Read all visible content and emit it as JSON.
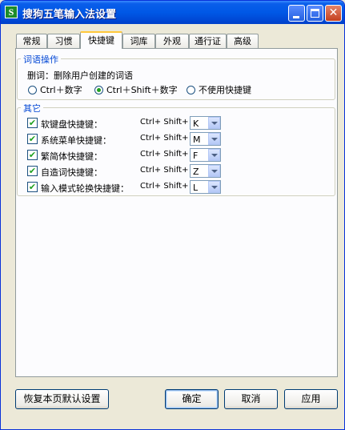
{
  "window": {
    "title": "搜狗五笔输入法设置"
  },
  "tabs": [
    "常规",
    "习惯",
    "快捷键",
    "词库",
    "外观",
    "通行证",
    "高级"
  ],
  "active_tab": "快捷键",
  "word_ops": {
    "group_label": "词语操作",
    "desc": "删词：删除用户创建的词语",
    "options": [
      "Ctrl＋数字",
      "Ctrl＋Shift＋数字",
      "不使用快捷键"
    ],
    "selected": 1
  },
  "other": {
    "group_label": "其它",
    "modifiers": "Ctrl+ Shift+",
    "rows": [
      {
        "label": "软键盘快捷键：",
        "key": "K",
        "checked": true
      },
      {
        "label": "系统菜单快捷键：",
        "key": "M",
        "checked": true
      },
      {
        "label": "繁简体快捷键：",
        "key": "F",
        "checked": true
      },
      {
        "label": "自造词快捷键：",
        "key": "Z",
        "checked": true
      },
      {
        "label": "输入模式轮换快捷键：",
        "key": "L",
        "checked": true
      }
    ]
  },
  "buttons": {
    "restore": "恢复本页默认设置",
    "ok": "确定",
    "cancel": "取消",
    "apply": "应用"
  },
  "icons": {
    "app": "sogou-s-icon",
    "min": "minimize-icon",
    "max": "maximize-icon",
    "close": "close-icon",
    "check": "checkmark-icon",
    "dropdown": "chevron-down-icon"
  },
  "app_icon_letter": "S"
}
